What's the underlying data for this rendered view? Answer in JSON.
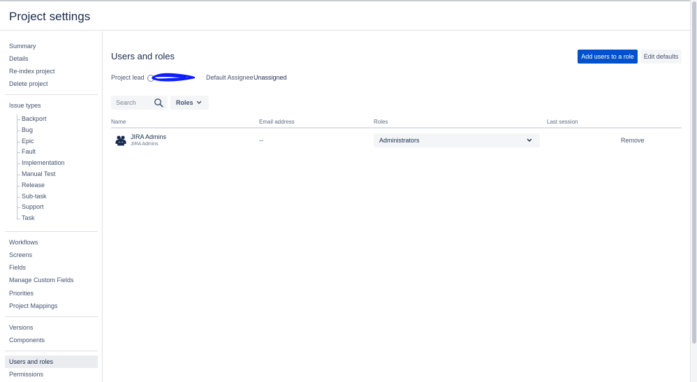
{
  "header": {
    "title": "Project settings"
  },
  "sidebar": {
    "items_top": [
      "Summary",
      "Details",
      "Re-index project",
      "Delete project"
    ],
    "issue_types_label": "Issue types",
    "issue_types": [
      "Backport",
      "Bug",
      "Epic",
      "Fault",
      "Implementation",
      "Manual Test",
      "Release",
      "Sub-task",
      "Support",
      "Task"
    ],
    "items_mid": [
      "Workflows",
      "Screens",
      "Fields",
      "Manage Custom Fields",
      "Priorities",
      "Project Mappings"
    ],
    "items_low": [
      "Versions",
      "Components"
    ],
    "items_bottom": [
      "Users and roles",
      "Permissions"
    ]
  },
  "main": {
    "title": "Users and roles",
    "add_button": "Add users to a role",
    "edit_defaults_button": "Edit defaults",
    "project_lead_label": "Project lead",
    "default_assignee_label": "Default Assignee",
    "default_assignee_value": "Unassigned",
    "search": {
      "placeholder": "Search"
    },
    "roles_filter": "Roles",
    "table": {
      "headers": {
        "name": "Name",
        "email": "Email address",
        "roles": "Roles",
        "last_session": "Last session"
      },
      "rows": [
        {
          "name": "JIRA Admins",
          "sub": "JIRA Admins",
          "email": "--",
          "role": "Administrators",
          "action": "Remove"
        }
      ]
    }
  },
  "icons": {
    "search": "search-icon",
    "chevron": "chevron-down-icon",
    "group": "group-icon",
    "avatar": "avatar-icon"
  },
  "colors": {
    "primary": "#0052cc",
    "redaction": "#0a1eff"
  }
}
